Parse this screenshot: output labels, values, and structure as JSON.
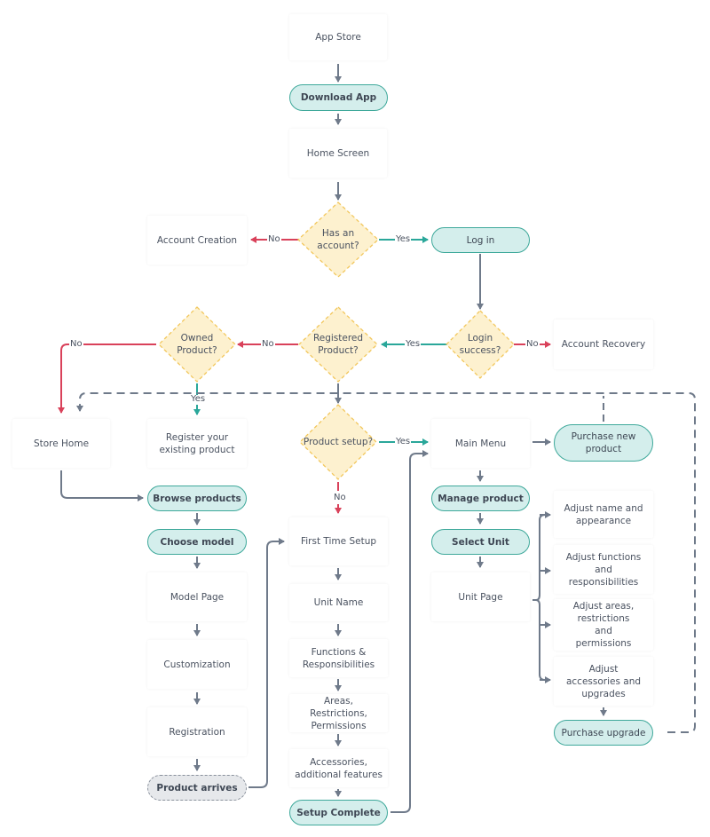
{
  "colors": {
    "pill_fill": "#d4eeec",
    "pill_stroke": "#3fa99b",
    "decision_fill": "#fdf1cf",
    "decision_stroke": "#f2c75c",
    "yes_arrow": "#2aa79a",
    "no_arrow": "#d9415a",
    "neutral_arrow": "#6f7a8a",
    "grey_pill_fill": "#e6e8eb"
  },
  "nodes": {
    "app_store": "App Store",
    "download_app": "Download App",
    "home_screen": "Home Screen",
    "has_account": "Has an account?",
    "account_creation": "Account Creation",
    "log_in": "Log in",
    "login_success": "Login success?",
    "account_recovery": "Account Recovery",
    "registered_product": "Registered Product?",
    "owned_product": "Owned Product?",
    "store_home": "Store Home",
    "register_existing": "Register your existing product",
    "product_setup": "Product setup?",
    "main_menu": "Main Menu",
    "purchase_new_product": "Purchase new product",
    "browse_products": "Browse products",
    "choose_model": "Choose model",
    "model_page": "Model Page",
    "customization": "Customization",
    "registration": "Registration",
    "product_arrives": "Product arrives",
    "first_time_setup": "First Time Setup",
    "unit_name": "Unit Name",
    "functions_responsibilities": "Functions & Responsibilities",
    "areas_restrictions": "Areas, Restrictions, Permissions",
    "accessories_features": "Accessories, additional features",
    "setup_complete": "Setup Complete",
    "manage_product": "Manage product",
    "select_unit": "Select Unit",
    "unit_page": "Unit Page",
    "adjust_name": "Adjust name and appearance",
    "adjust_functions": "Adjust functions and responsibilities",
    "adjust_areas": "Adjust areas, restrictions and permissions",
    "adjust_accessories": "Adjust accessories and upgrades",
    "purchase_upgrade": "Purchase upgrade"
  },
  "labels": {
    "has_account_no": "No",
    "has_account_yes": "Yes",
    "login_yes": "Yes",
    "login_no": "No",
    "registered_no": "No",
    "owned_no": "No",
    "owned_yes": "Yes",
    "setup_yes": "Yes",
    "setup_no": "No"
  }
}
